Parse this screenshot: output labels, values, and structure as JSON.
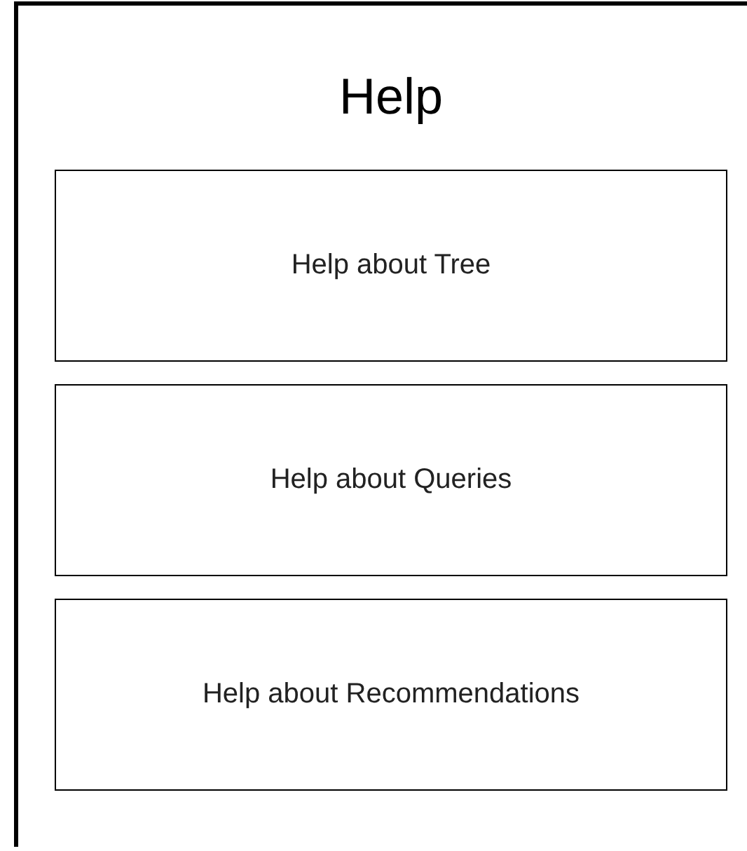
{
  "title": "Help",
  "buttons": [
    {
      "label": "Help about Tree"
    },
    {
      "label": "Help about Queries"
    },
    {
      "label": "Help about Recommendations"
    }
  ]
}
